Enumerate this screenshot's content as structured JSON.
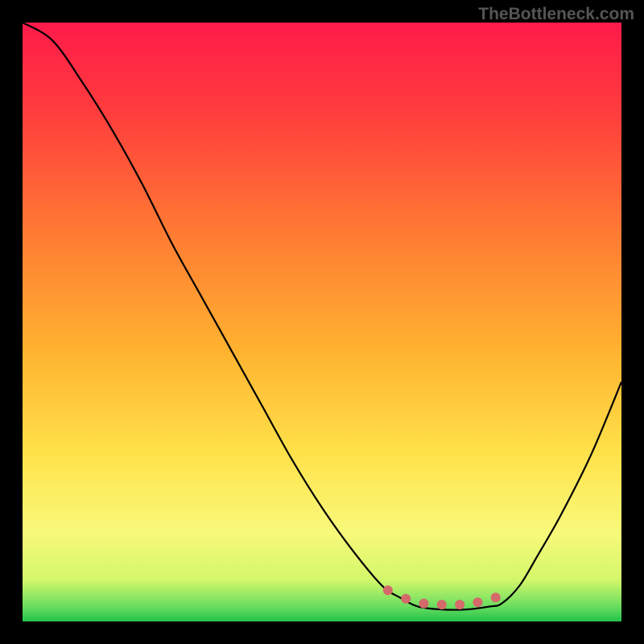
{
  "watermark": "TheBottleneck.com",
  "chart_data": {
    "type": "line",
    "title": "",
    "xlabel": "",
    "ylabel": "",
    "x": [
      0.0,
      0.05,
      0.1,
      0.15,
      0.2,
      0.25,
      0.3,
      0.35,
      0.4,
      0.45,
      0.5,
      0.55,
      0.6,
      0.63,
      0.66,
      0.7,
      0.74,
      0.78,
      0.8,
      0.83,
      0.86,
      0.9,
      0.95,
      1.0
    ],
    "values": [
      1.0,
      0.97,
      0.9,
      0.82,
      0.73,
      0.63,
      0.54,
      0.45,
      0.36,
      0.27,
      0.19,
      0.12,
      0.06,
      0.04,
      0.025,
      0.02,
      0.02,
      0.025,
      0.03,
      0.06,
      0.11,
      0.18,
      0.28,
      0.4
    ],
    "xlim": [
      0,
      1
    ],
    "ylim": [
      0,
      1
    ],
    "gradient_stops": [
      {
        "offset": 0.0,
        "color": "#ff1a4a"
      },
      {
        "offset": 0.15,
        "color": "#ff3d3d"
      },
      {
        "offset": 0.35,
        "color": "#ff7a33"
      },
      {
        "offset": 0.55,
        "color": "#ffb330"
      },
      {
        "offset": 0.72,
        "color": "#ffe24a"
      },
      {
        "offset": 0.85,
        "color": "#f8f97a"
      },
      {
        "offset": 0.93,
        "color": "#d4f76a"
      },
      {
        "offset": 0.975,
        "color": "#6add60"
      },
      {
        "offset": 1.0,
        "color": "#22c24a"
      }
    ],
    "marker_region": {
      "x": [
        0.61,
        0.64,
        0.67,
        0.7,
        0.73,
        0.76,
        0.79
      ],
      "y": [
        0.052,
        0.038,
        0.03,
        0.028,
        0.028,
        0.032,
        0.04
      ],
      "color": "#d46a6a"
    }
  }
}
